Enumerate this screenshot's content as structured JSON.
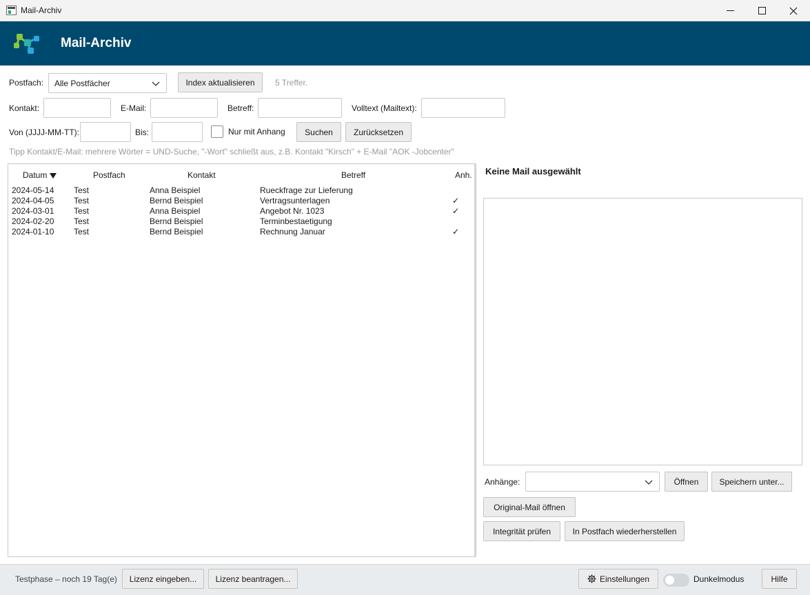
{
  "window": {
    "title": "Mail-Archiv"
  },
  "header": {
    "app_name": "Mail-Archiv",
    "brand_color": "#00496e"
  },
  "filters": {
    "postfach_label": "Postfach:",
    "postfach_value": "Alle Postfächer",
    "index_button": "Index aktualisieren",
    "result_count": "5 Treffer.",
    "kontakt_label": "Kontakt:",
    "kontakt_value": "",
    "email_label": "E-Mail:",
    "email_value": "",
    "betreff_label": "Betreff:",
    "betreff_value": "",
    "volltext_label": "Volltext (Mailtext):",
    "volltext_value": "",
    "von_label": "Von (JJJJ-MM-TT):",
    "von_value": "",
    "bis_label": "Bis:",
    "bis_value": "",
    "attachment_only_label": "Nur mit Anhang",
    "attachment_only_checked": false,
    "search_button": "Suchen",
    "reset_button": "Zurücksetzen",
    "tip": "Tipp Kontakt/E-Mail: mehrere Wörter = UND-Suche, \"-Wort\" schließt aus, z.B. Kontakt \"Kirsch\" + E-Mail \"AOK -Jobcenter\""
  },
  "table": {
    "columns": {
      "datum": "Datum",
      "postfach": "Postfach",
      "kontakt": "Kontakt",
      "betreff": "Betreff",
      "anh": "Anh."
    },
    "rows": [
      {
        "datum": "2024-05-14",
        "postfach": "Test",
        "kontakt": "Anna Beispiel",
        "betreff": "Rueckfrage zur Lieferung",
        "anh": ""
      },
      {
        "datum": "2024-04-05",
        "postfach": "Test",
        "kontakt": "Bernd Beispiel",
        "betreff": "Vertragsunterlagen",
        "anh": "✓"
      },
      {
        "datum": "2024-03-01",
        "postfach": "Test",
        "kontakt": "Anna Beispiel",
        "betreff": "Angebot Nr. 1023",
        "anh": "✓"
      },
      {
        "datum": "2024-02-20",
        "postfach": "Test",
        "kontakt": "Bernd Beispiel",
        "betreff": "Terminbestaetigung",
        "anh": ""
      },
      {
        "datum": "2024-01-10",
        "postfach": "Test",
        "kontakt": "Bernd Beispiel",
        "betreff": "Rechnung Januar",
        "anh": "✓"
      }
    ]
  },
  "preview": {
    "title": "Keine Mail ausgewählt",
    "attachments_label": "Anhänge:",
    "attachments_value": "",
    "open_button": "Öffnen",
    "save_as_button": "Speichern unter...",
    "open_original_button": "Original-Mail öffnen",
    "check_integrity_button": "Integrität prüfen",
    "restore_button": "In Postfach wiederherstellen"
  },
  "footer": {
    "trial_text": "Testphase – noch 19 Tag(e)",
    "enter_license_button": "Lizenz eingeben...",
    "request_license_button": "Lizenz beantragen...",
    "settings_button": "Einstellungen",
    "dark_mode_label": "Dunkelmodus",
    "dark_mode_on": false,
    "help_button": "Hilfe"
  }
}
